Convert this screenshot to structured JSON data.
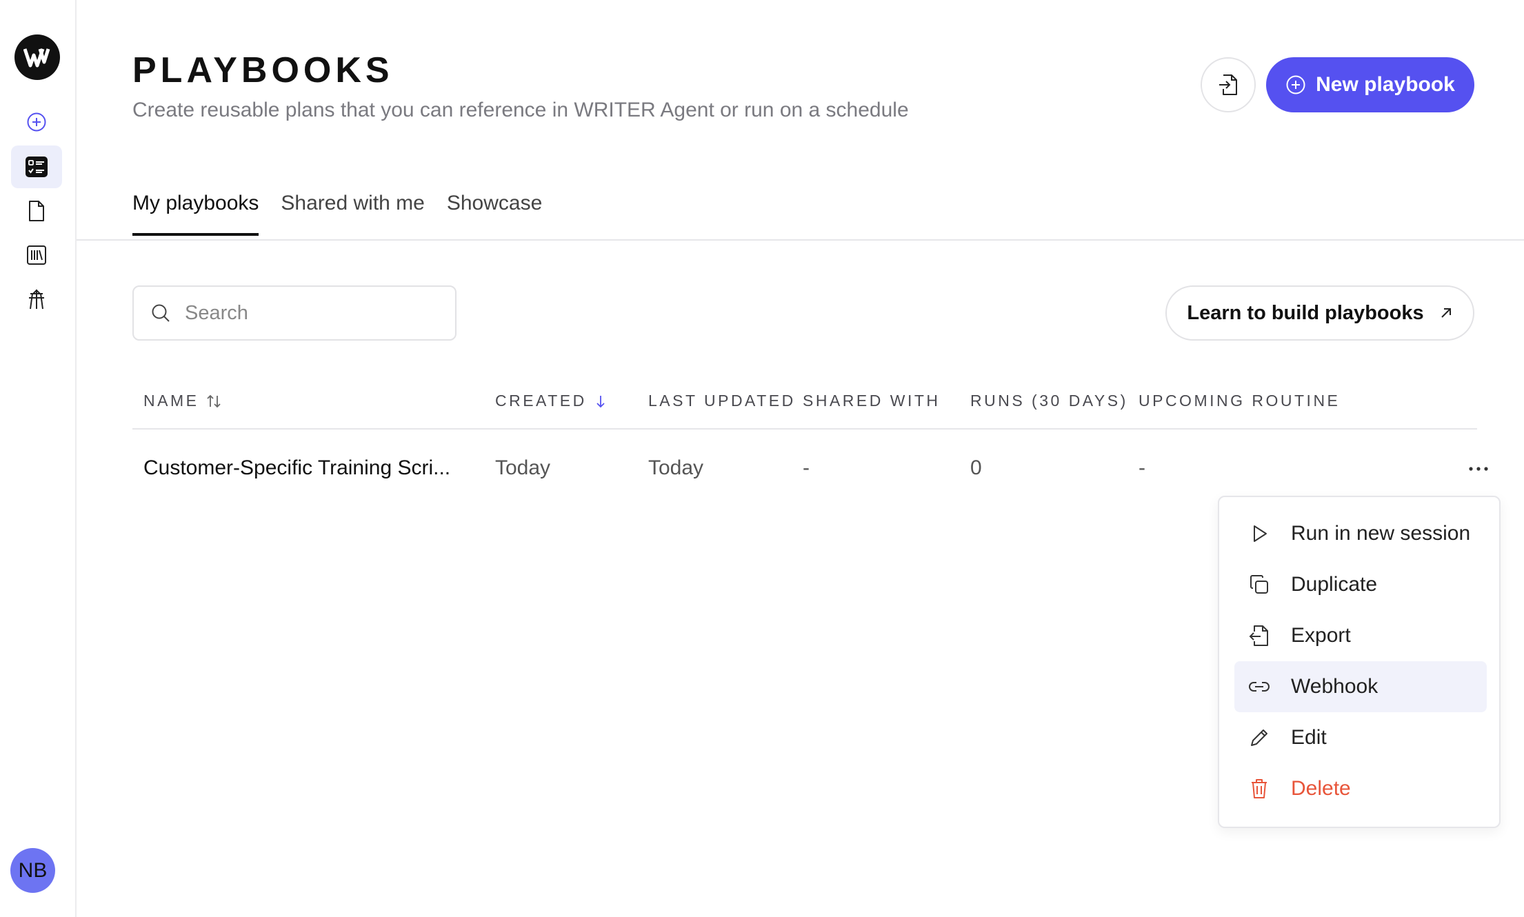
{
  "header": {
    "title": "PLAYBOOKS",
    "subtitle": "Create reusable plans that you can reference in WRITER Agent or run on a schedule",
    "new_button_label": "New playbook"
  },
  "tabs": [
    {
      "label": "My playbooks",
      "active": true
    },
    {
      "label": "Shared with me",
      "active": false
    },
    {
      "label": "Showcase",
      "active": false
    }
  ],
  "search": {
    "placeholder": "Search"
  },
  "learn_button_label": "Learn to build playbooks",
  "table": {
    "columns": [
      "NAME",
      "CREATED",
      "LAST UPDATED",
      "SHARED WITH",
      "RUNS (30 DAYS)",
      "UPCOMING ROUTINE"
    ],
    "rows": [
      {
        "name": "Customer-Specific Training Scri...",
        "created": "Today",
        "last_updated": "Today",
        "shared_with": "-",
        "runs": "0",
        "upcoming_routine": "-"
      }
    ]
  },
  "row_menu": {
    "items": [
      {
        "label": "Run in new session",
        "icon": "play-icon"
      },
      {
        "label": "Duplicate",
        "icon": "copy-icon"
      },
      {
        "label": "Export",
        "icon": "export-icon"
      },
      {
        "label": "Webhook",
        "icon": "link-icon"
      },
      {
        "label": "Edit",
        "icon": "pencil-icon"
      },
      {
        "label": "Delete",
        "icon": "trash-icon"
      }
    ],
    "hovered": "Webhook"
  },
  "user": {
    "initials": "NB"
  },
  "colors": {
    "accent": "#5551f0",
    "danger": "#e8553a",
    "avatar": "#6d74f2",
    "active_nav_bg": "#eceefb"
  }
}
